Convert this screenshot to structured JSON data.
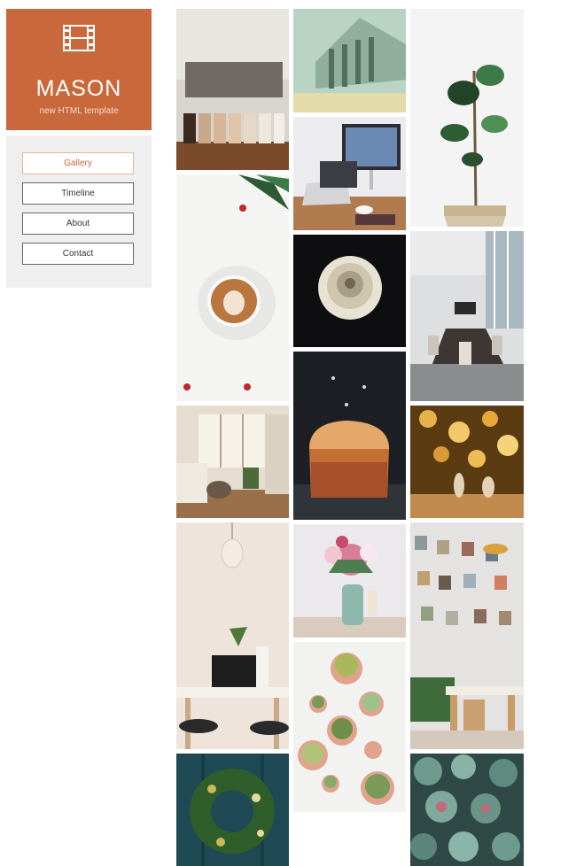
{
  "brand": {
    "title": "MASON",
    "subtitle": "new HTML template",
    "icon": "film-icon",
    "color": "#c9683a"
  },
  "nav": {
    "items": [
      {
        "label": "Gallery",
        "active": true
      },
      {
        "label": "Timeline",
        "active": false
      },
      {
        "label": "About",
        "active": false
      },
      {
        "label": "Contact",
        "active": false
      }
    ]
  },
  "gallery": {
    "photos": [
      "coffee-bar-jars",
      "banknote-building",
      "potted-tree",
      "laptop-desk",
      "latte-art",
      "white-rose",
      "conference-room",
      "panettone",
      "cozy-living-room",
      "bokeh-nativity",
      "white-desk-laptop",
      "flower-vase",
      "wall-photos-dining",
      "succulent-pots",
      "holiday-wreath",
      "succulents-closeup"
    ]
  }
}
